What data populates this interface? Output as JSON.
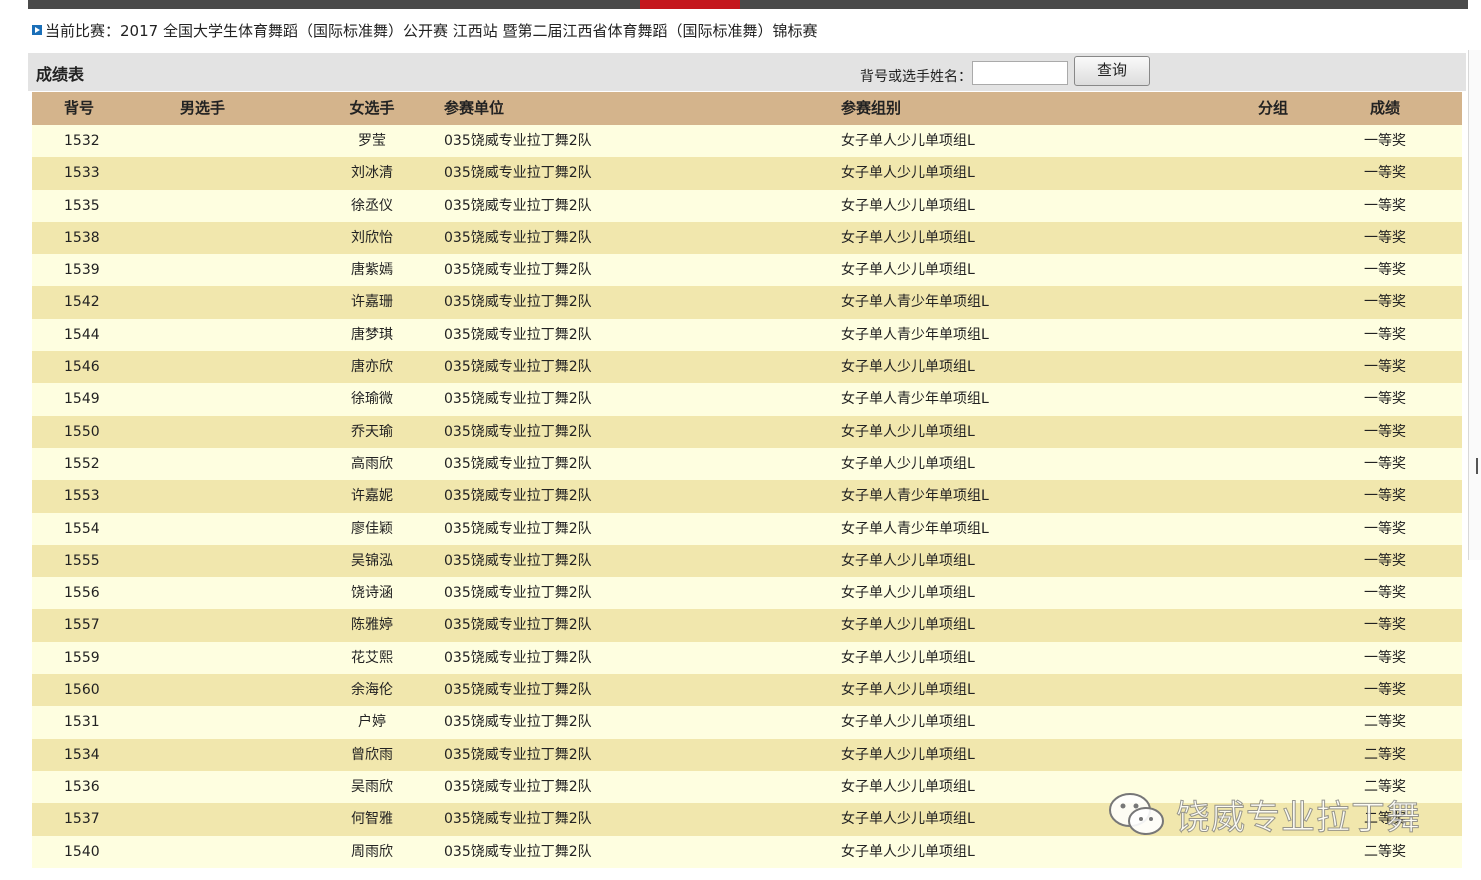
{
  "header": {
    "current_match_label": "当前比赛：2017 全国大学生体育舞蹈（国际标准舞）公开赛  江西站  暨第二届江西省体育舞蹈（国际标准舞）锦标赛"
  },
  "results_bar": {
    "title": "成绩表",
    "search_label": "背号或选手姓名：",
    "search_value": "",
    "search_button": "查询"
  },
  "table": {
    "columns": [
      "背号",
      "男选手",
      "女选手",
      "参赛单位",
      "参赛组别",
      "分组",
      "成绩"
    ],
    "rows": [
      {
        "bib": "1532",
        "male": "",
        "female": "罗莹",
        "unit": "035饶威专业拉丁舞2队",
        "group": "女子单人少儿单项组L",
        "sub": "",
        "result": "一等奖"
      },
      {
        "bib": "1533",
        "male": "",
        "female": "刘冰清",
        "unit": "035饶威专业拉丁舞2队",
        "group": "女子单人少儿单项组L",
        "sub": "",
        "result": "一等奖"
      },
      {
        "bib": "1535",
        "male": "",
        "female": "徐丞仪",
        "unit": "035饶威专业拉丁舞2队",
        "group": "女子单人少儿单项组L",
        "sub": "",
        "result": "一等奖"
      },
      {
        "bib": "1538",
        "male": "",
        "female": "刘欣怡",
        "unit": "035饶威专业拉丁舞2队",
        "group": "女子单人少儿单项组L",
        "sub": "",
        "result": "一等奖"
      },
      {
        "bib": "1539",
        "male": "",
        "female": "唐紫嫣",
        "unit": "035饶威专业拉丁舞2队",
        "group": "女子单人少儿单项组L",
        "sub": "",
        "result": "一等奖"
      },
      {
        "bib": "1542",
        "male": "",
        "female": "许嘉珊",
        "unit": "035饶威专业拉丁舞2队",
        "group": "女子单人青少年单项组L",
        "sub": "",
        "result": "一等奖"
      },
      {
        "bib": "1544",
        "male": "",
        "female": "唐梦琪",
        "unit": "035饶威专业拉丁舞2队",
        "group": "女子单人青少年单项组L",
        "sub": "",
        "result": "一等奖"
      },
      {
        "bib": "1546",
        "male": "",
        "female": "唐亦欣",
        "unit": "035饶威专业拉丁舞2队",
        "group": "女子单人少儿单项组L",
        "sub": "",
        "result": "一等奖"
      },
      {
        "bib": "1549",
        "male": "",
        "female": "徐瑜微",
        "unit": "035饶威专业拉丁舞2队",
        "group": "女子单人青少年单项组L",
        "sub": "",
        "result": "一等奖"
      },
      {
        "bib": "1550",
        "male": "",
        "female": "乔天瑜",
        "unit": "035饶威专业拉丁舞2队",
        "group": "女子单人少儿单项组L",
        "sub": "",
        "result": "一等奖"
      },
      {
        "bib": "1552",
        "male": "",
        "female": "高雨欣",
        "unit": "035饶威专业拉丁舞2队",
        "group": "女子单人少儿单项组L",
        "sub": "",
        "result": "一等奖"
      },
      {
        "bib": "1553",
        "male": "",
        "female": "许嘉妮",
        "unit": "035饶威专业拉丁舞2队",
        "group": "女子单人青少年单项组L",
        "sub": "",
        "result": "一等奖"
      },
      {
        "bib": "1554",
        "male": "",
        "female": "廖佳颖",
        "unit": "035饶威专业拉丁舞2队",
        "group": "女子单人青少年单项组L",
        "sub": "",
        "result": "一等奖"
      },
      {
        "bib": "1555",
        "male": "",
        "female": "吴锦泓",
        "unit": "035饶威专业拉丁舞2队",
        "group": "女子单人少儿单项组L",
        "sub": "",
        "result": "一等奖"
      },
      {
        "bib": "1556",
        "male": "",
        "female": "饶诗涵",
        "unit": "035饶威专业拉丁舞2队",
        "group": "女子单人少儿单项组L",
        "sub": "",
        "result": "一等奖"
      },
      {
        "bib": "1557",
        "male": "",
        "female": "陈雅婷",
        "unit": "035饶威专业拉丁舞2队",
        "group": "女子单人少儿单项组L",
        "sub": "",
        "result": "一等奖"
      },
      {
        "bib": "1559",
        "male": "",
        "female": "花艾熙",
        "unit": "035饶威专业拉丁舞2队",
        "group": "女子单人少儿单项组L",
        "sub": "",
        "result": "一等奖"
      },
      {
        "bib": "1560",
        "male": "",
        "female": "余海伦",
        "unit": "035饶威专业拉丁舞2队",
        "group": "女子单人少儿单项组L",
        "sub": "",
        "result": "一等奖"
      },
      {
        "bib": "1531",
        "male": "",
        "female": "户婷",
        "unit": "035饶威专业拉丁舞2队",
        "group": "女子单人少儿单项组L",
        "sub": "",
        "result": "二等奖"
      },
      {
        "bib": "1534",
        "male": "",
        "female": "曾欣雨",
        "unit": "035饶威专业拉丁舞2队",
        "group": "女子单人少儿单项组L",
        "sub": "",
        "result": "二等奖"
      },
      {
        "bib": "1536",
        "male": "",
        "female": "吴雨欣",
        "unit": "035饶威专业拉丁舞2队",
        "group": "女子单人少儿单项组L",
        "sub": "",
        "result": "二等奖"
      },
      {
        "bib": "1537",
        "male": "",
        "female": "何智雅",
        "unit": "035饶威专业拉丁舞2队",
        "group": "女子单人少儿单项组L",
        "sub": "",
        "result": "二等奖"
      },
      {
        "bib": "1540",
        "male": "",
        "female": "周雨欣",
        "unit": "035饶威专业拉丁舞2队",
        "group": "女子单人少儿单项组L",
        "sub": "",
        "result": "二等奖"
      }
    ]
  },
  "watermark": {
    "text": "饶威专业拉丁舞",
    "icon": "wechat-icon"
  }
}
